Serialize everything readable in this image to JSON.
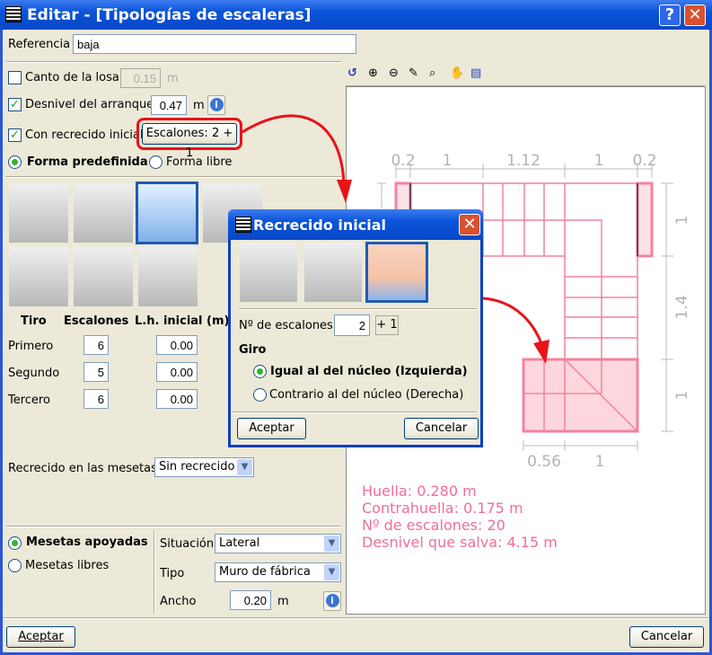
{
  "window": {
    "title": "Editar - [Tipologías de escaleras]",
    "help": "?",
    "close": "✕"
  },
  "referencia": {
    "label": "Referencia",
    "value": "baja"
  },
  "canto": {
    "label": "Canto de la losa",
    "value": "0.15",
    "unit": "m",
    "checked": false
  },
  "desnivel": {
    "label": "Desnivel del arranque",
    "value": "0.47",
    "unit": "m",
    "checked": true
  },
  "recrecido": {
    "label": "Con recrecido inicial",
    "button": "Escalones: 2 + 1",
    "checked": true
  },
  "forma": {
    "predefinida": "Forma predefinida",
    "libre": "Forma libre",
    "selected": "predefinida"
  },
  "table": {
    "headers": [
      "Tiro",
      "Escalones",
      "L.h. inicial (m)"
    ],
    "rows": [
      {
        "name": "Primero",
        "escalones": "6",
        "lh": "0.00"
      },
      {
        "name": "Segundo",
        "escalones": "5",
        "lh": "0.00"
      },
      {
        "name": "Tercero",
        "escalones": "6",
        "lh": "0.00"
      }
    ]
  },
  "mesetas_recrecido": {
    "label": "Recrecido en las mesetas",
    "value": "Sin recrecido"
  },
  "mesetas": {
    "apoyadas": "Mesetas apoyadas",
    "libres": "Mesetas libres",
    "situacion_label": "Situación",
    "situacion": "Lateral",
    "tipo_label": "Tipo",
    "tipo": "Muro de fábrica",
    "ancho_label": "Ancho",
    "ancho": "0.20",
    "unit": "m"
  },
  "buttons": {
    "aceptar": "Aceptar",
    "cancelar": "Cancelar"
  },
  "plan": {
    "dims_top": [
      "0.2",
      "1",
      "1.12",
      "1",
      "0.2"
    ],
    "dims_right": [
      "1",
      "1.4",
      "1"
    ],
    "dims_bottom": [
      "0.56",
      "1"
    ],
    "info": [
      "Huella: 0.280 m",
      "Contrahuella: 0.175 m",
      "Nº de escalones: 20",
      "Desnivel que salva: 4.15 m"
    ],
    "color": "#f06e98"
  },
  "popup": {
    "title": "Recrecido inicial",
    "n_label": "Nº de escalones",
    "n_value": "2",
    "plus": "+ 1",
    "giro": "Giro",
    "igual": "Igual al del núcleo (Izquierda)",
    "contrario": "Contrario al del núcleo (Derecha)",
    "aceptar": "Aceptar",
    "cancelar": "Cancelar"
  }
}
